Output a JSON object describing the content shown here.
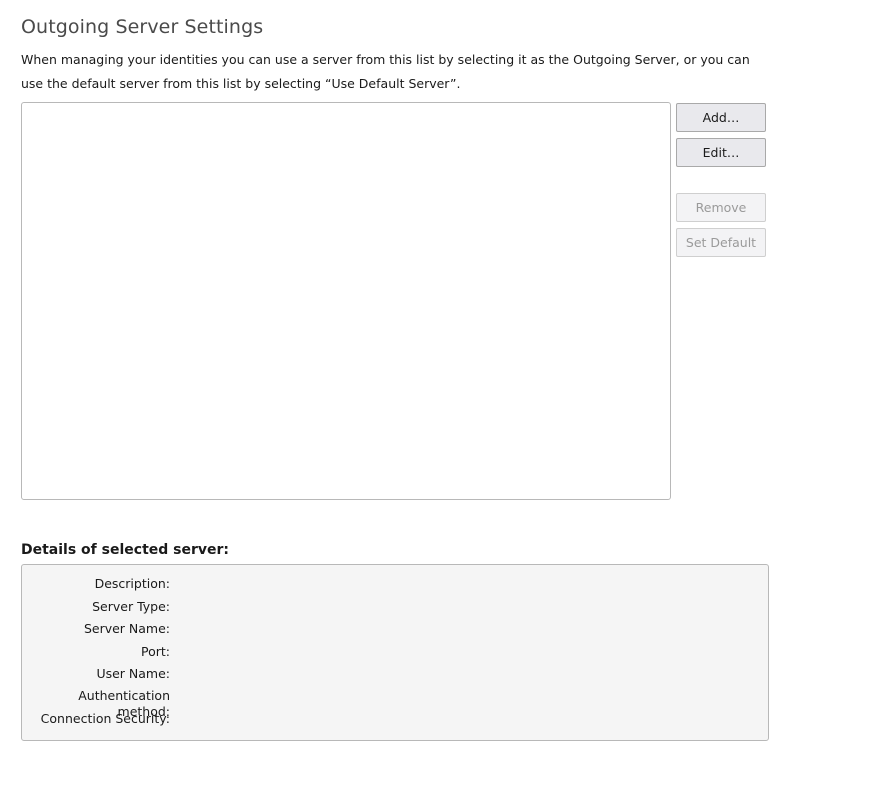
{
  "page": {
    "title": "Outgoing Server Settings",
    "description": "When managing your identities you can use a server from this list by selecting it as the Outgoing Server, or you can use the default server from this list by selecting “Use Default Server”."
  },
  "buttons": {
    "add": "Add…",
    "edit": "Edit…",
    "remove": "Remove",
    "set_default": "Set Default"
  },
  "server_list": {
    "items": []
  },
  "details": {
    "heading": "Details of selected server:",
    "fields": [
      {
        "label": "Description:",
        "value": ""
      },
      {
        "label": "Server Type:",
        "value": ""
      },
      {
        "label": "Server Name:",
        "value": ""
      },
      {
        "label": "Port:",
        "value": ""
      },
      {
        "label": "User Name:",
        "value": ""
      },
      {
        "label": "Authentication method:",
        "value": ""
      },
      {
        "label": "Connection Security:",
        "value": ""
      }
    ]
  }
}
